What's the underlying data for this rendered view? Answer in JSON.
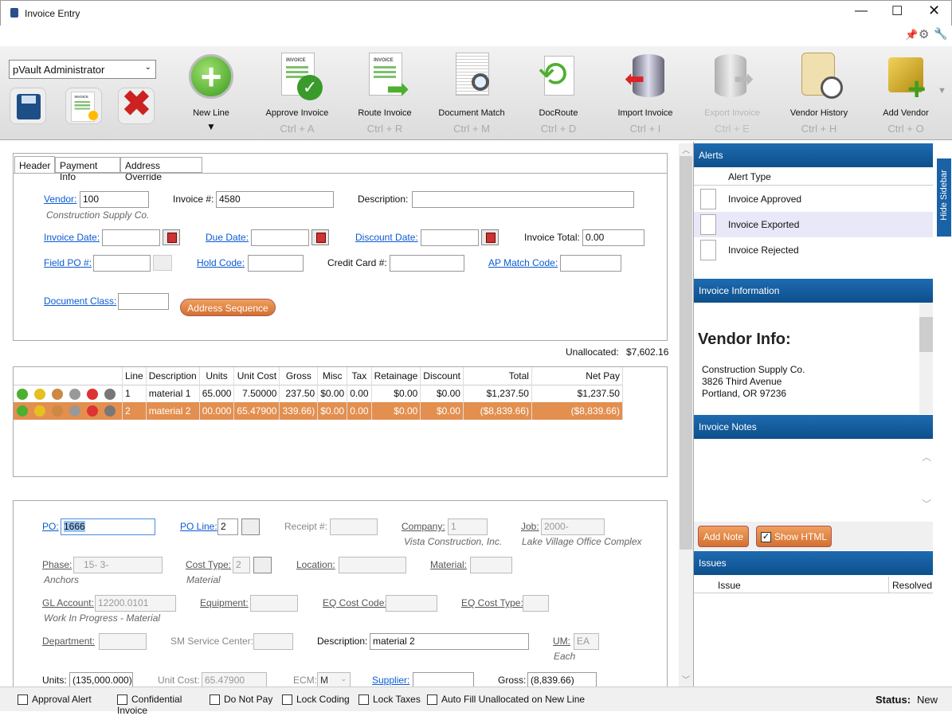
{
  "window": {
    "title": "Invoice Entry"
  },
  "user_select": {
    "value": "pVault Administrator"
  },
  "toolbar": [
    {
      "label": "New Line",
      "shortcut": "",
      "icon": "plus-circle-icon"
    },
    {
      "label": "Approve Invoice",
      "shortcut": "Ctrl + A",
      "icon": "approve-invoice-icon"
    },
    {
      "label": "Route Invoice",
      "shortcut": "Ctrl + R",
      "icon": "route-invoice-icon"
    },
    {
      "label": "Document Match",
      "shortcut": "Ctrl + M",
      "icon": "document-match-icon"
    },
    {
      "label": "DocRoute",
      "shortcut": "Ctrl + D",
      "icon": "docroute-icon"
    },
    {
      "label": "Import Invoice",
      "shortcut": "Ctrl + I",
      "icon": "import-invoice-icon"
    },
    {
      "label": "Export Invoice",
      "shortcut": "Ctrl + E",
      "icon": "export-invoice-icon",
      "disabled": true
    },
    {
      "label": "Vendor History",
      "shortcut": "Ctrl + H",
      "icon": "vendor-history-icon"
    },
    {
      "label": "Add Vendor",
      "shortcut": "Ctrl + O",
      "icon": "add-vendor-icon"
    }
  ],
  "tabs": [
    "Header",
    "Payment Info",
    "Address Override"
  ],
  "header": {
    "vendor_label": "Vendor:",
    "vendor": "100",
    "vendor_name": "Construction Supply Co.",
    "invoice_no_label": "Invoice #:",
    "invoice_no": "4580",
    "description_label": "Description:",
    "description": "",
    "invoice_date_label": "Invoice Date:",
    "due_date_label": "Due Date:",
    "discount_date_label": "Discount Date:",
    "invoice_total_label": "Invoice Total:",
    "invoice_total": "0.00",
    "field_po_label": "Field PO #:",
    "hold_code_label": "Hold Code:",
    "credit_card_label": "Credit Card #:",
    "ap_match_label": "AP Match Code:",
    "document_class_label": "Document Class:",
    "address_sequence": "Address Sequence"
  },
  "unallocated": {
    "label": "Unallocated:",
    "value": "$7,602.16"
  },
  "lines": {
    "columns": [
      "Line",
      "Description",
      "Units",
      "Unit Cost",
      "Gross",
      "Misc",
      "Tax",
      "Retainage",
      "Discount",
      "Total",
      "Net Pay"
    ],
    "rows": [
      [
        "1",
        "material 1",
        "65.000",
        "7.50000",
        "237.50",
        "$0.00",
        "0.00",
        "$0.00",
        "$0.00",
        "$1,237.50",
        "$1,237.50"
      ],
      [
        "2",
        "material 2",
        "00.000",
        "65.47900",
        "339.66)",
        "$0.00",
        "0.00",
        "$0.00",
        "$0.00",
        "($8,839.66)",
        "($8,839.66)"
      ]
    ]
  },
  "detail": {
    "po_label": "PO:",
    "po": "1666",
    "po_line_label": "PO Line:",
    "po_line": "2",
    "receipt_label": "Receipt #:",
    "company_label": "Company:",
    "company": "1",
    "company_name": "Vista Construction, Inc.",
    "job_label": "Job:",
    "job": "2000-",
    "job_name": "Lake Village Office Complex",
    "phase_label": "Phase:",
    "phase": "15- 3-",
    "phase_name": "Anchors",
    "cost_type_label": "Cost Type:",
    "cost_type": "2",
    "cost_type_name": "Material",
    "location_label": "Location:",
    "material_label": "Material:",
    "gl_label": "GL Account:",
    "gl": "12200.0101",
    "gl_name": "Work In Progress - Material",
    "equipment_label": "Equipment:",
    "eq_cost_code_label": "EQ Cost Code:",
    "eq_cost_type_label": "EQ Cost Type:",
    "department_label": "Department:",
    "sm_label": "SM Service Center:",
    "description_label": "Description:",
    "description": "material 2",
    "um_label": "UM:",
    "um": "EA",
    "um_name": "Each",
    "units_label": "Units:",
    "units": "(135,000.000)",
    "unit_cost_label": "Unit Cost:",
    "unit_cost": "65.47900",
    "ecm_label": "ECM:",
    "ecm": "M",
    "supplier_label": "Supplier:",
    "gross_label": "Gross:",
    "gross": "(8,839.66)"
  },
  "sidebar": {
    "hide_label": "Hide Sidebar",
    "alerts_title": "Alerts",
    "alert_type_header": "Alert Type",
    "alerts": [
      "Invoice Approved",
      "Invoice Exported",
      "Invoice Rejected"
    ],
    "info_title": "Invoice Information",
    "vendor_info_title": "Vendor Info:",
    "vendor_lines": [
      "Construction Supply Co.",
      "3826 Third Avenue",
      "Portland, OR 97236"
    ],
    "notes_title": "Invoice Notes",
    "add_note": "Add Note",
    "show_html": "Show HTML",
    "issues_title": "Issues",
    "issue_header": "Issue",
    "resolved_header": "Resolved"
  },
  "footer": {
    "checks": [
      "Approval Alert",
      "Confidential Invoice",
      "Do Not Pay",
      "Lock Coding",
      "Lock Taxes",
      "Auto Fill Unallocated on New Line"
    ],
    "status_label": "Status:",
    "status": "New"
  }
}
